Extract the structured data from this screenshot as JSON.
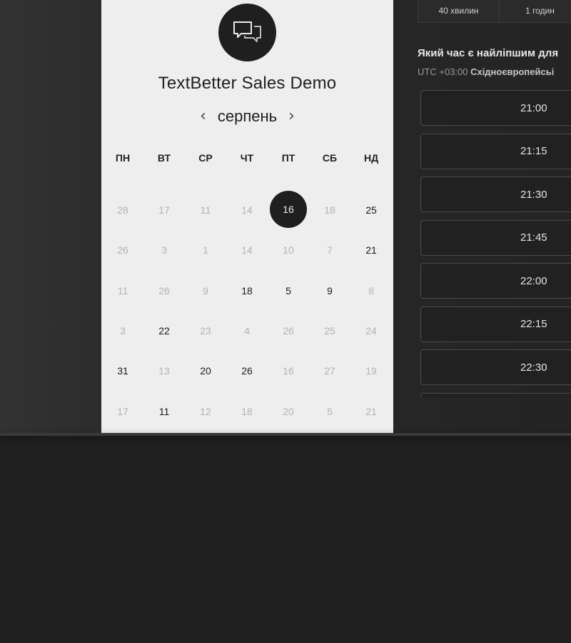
{
  "event": {
    "title": "TextBetter Sales Demo",
    "icon": "chat-bubbles-icon"
  },
  "calendar": {
    "month": "серпень",
    "prev_arrow": "‹",
    "next_arrow": "›",
    "weekdays": [
      "ПН",
      "ВТ",
      "СР",
      "ЧТ",
      "ПТ",
      "СБ",
      "НД"
    ],
    "weeks": [
      [
        {
          "d": "28",
          "a": false
        },
        {
          "d": "17",
          "a": false
        },
        {
          "d": "11",
          "a": false
        },
        {
          "d": "14",
          "a": false
        },
        {
          "d": "16",
          "a": true,
          "sel": true
        },
        {
          "d": "18",
          "a": false
        },
        {
          "d": "25",
          "a": true
        }
      ],
      [
        {
          "d": "26",
          "a": false
        },
        {
          "d": "3",
          "a": false
        },
        {
          "d": "1",
          "a": false
        },
        {
          "d": "14",
          "a": false
        },
        {
          "d": "10",
          "a": false
        },
        {
          "d": "7",
          "a": false
        },
        {
          "d": "21",
          "a": true
        }
      ],
      [
        {
          "d": "11",
          "a": false
        },
        {
          "d": "26",
          "a": false
        },
        {
          "d": "9",
          "a": false
        },
        {
          "d": "18",
          "a": true
        },
        {
          "d": "5",
          "a": true
        },
        {
          "d": "9",
          "a": true
        },
        {
          "d": "8",
          "a": false
        }
      ],
      [
        {
          "d": "3",
          "a": false
        },
        {
          "d": "22",
          "a": true
        },
        {
          "d": "23",
          "a": false
        },
        {
          "d": "4",
          "a": false
        },
        {
          "d": "26",
          "a": false
        },
        {
          "d": "25",
          "a": false
        },
        {
          "d": "24",
          "a": false
        }
      ],
      [
        {
          "d": "31",
          "a": true
        },
        {
          "d": "13",
          "a": false
        },
        {
          "d": "20",
          "a": true
        },
        {
          "d": "26",
          "a": true
        },
        {
          "d": "16",
          "a": false
        },
        {
          "d": "27",
          "a": false
        },
        {
          "d": "19",
          "a": false
        }
      ],
      [
        {
          "d": "17",
          "a": false
        },
        {
          "d": "11",
          "a": true
        },
        {
          "d": "12",
          "a": false
        },
        {
          "d": "18",
          "a": false
        },
        {
          "d": "20",
          "a": false
        },
        {
          "d": "5",
          "a": false
        },
        {
          "d": "21",
          "a": false
        }
      ]
    ]
  },
  "durations": [
    "40 хвилин",
    "1 годин"
  ],
  "times": {
    "question": "Який час є найліпшим для",
    "timezone_offset": "UTC +03:00",
    "timezone_name": "Східноєвропейсьі",
    "slots": [
      "21:00",
      "21:15",
      "21:30",
      "21:45",
      "22:00",
      "22:15",
      "22:30",
      ""
    ]
  },
  "colors": {
    "card_bg": "#eeeeee",
    "page_bg": "#202020",
    "selected_day": "#1f1f1f"
  }
}
